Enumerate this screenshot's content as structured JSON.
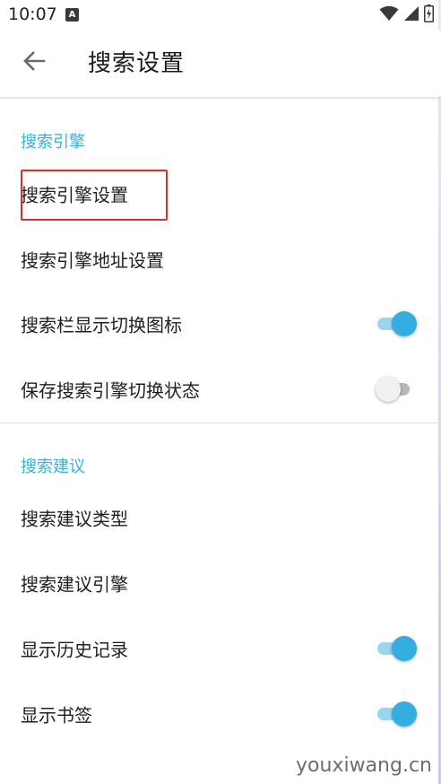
{
  "status_bar": {
    "time": "10:07",
    "notification_icon": "A"
  },
  "app_bar": {
    "back_icon": "arrow-left-icon",
    "title": "搜索设置"
  },
  "sections": [
    {
      "header": "搜索引擎",
      "items": [
        {
          "label": "搜索引擎设置"
        },
        {
          "label": "搜索引擎地址设置"
        },
        {
          "label": "搜索栏显示切换图标",
          "switch": true
        },
        {
          "label": "保存搜索引擎切换状态",
          "switch": false
        }
      ]
    },
    {
      "header": "搜索建议",
      "items": [
        {
          "label": "搜索建议类型"
        },
        {
          "label": "搜索建议引擎"
        },
        {
          "label": "显示历史记录",
          "switch": true
        },
        {
          "label": "显示书签",
          "switch": true
        }
      ]
    }
  ],
  "colors": {
    "accent": "#34aee0",
    "section_header": "#3ab0d8",
    "highlight": "#d9302c"
  },
  "watermark": "youxiwang.cn"
}
